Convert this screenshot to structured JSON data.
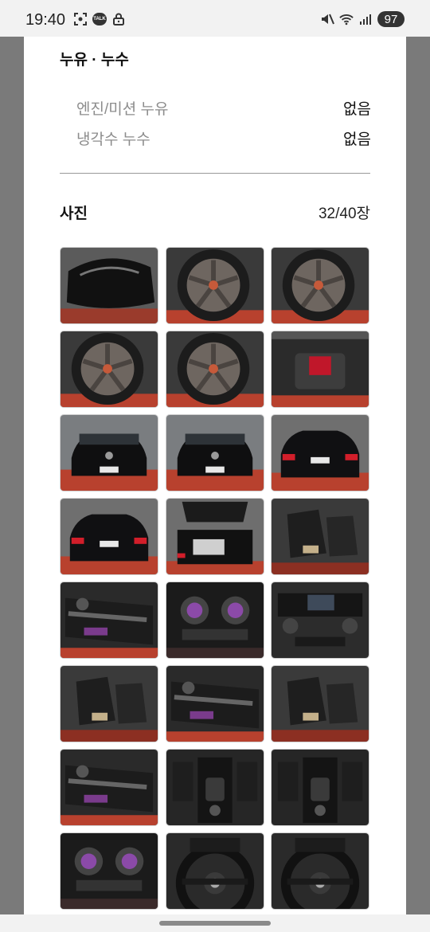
{
  "status_bar": {
    "time": "19:40",
    "talk_badge": "TALK",
    "battery": "97",
    "icons": [
      "screenshot-icon",
      "kakaotalk-icon",
      "lock-icon",
      "mute-icon",
      "wifi-icon",
      "signal-icon",
      "battery-icon"
    ]
  },
  "leak": {
    "title": "누유 · 누수",
    "rows": [
      {
        "label": "엔진/미션 누유",
        "value": "없음"
      },
      {
        "label": "냉각수 누수",
        "value": "없음"
      }
    ]
  },
  "photos": {
    "title": "사진",
    "count": "32/40장",
    "items": [
      {
        "name": "side-mirror-photo",
        "kind": "mirror"
      },
      {
        "name": "wheel-photo",
        "kind": "wheel"
      },
      {
        "name": "wheel-photo",
        "kind": "wheel"
      },
      {
        "name": "wheel-photo",
        "kind": "wheel"
      },
      {
        "name": "wheel-photo",
        "kind": "wheel"
      },
      {
        "name": "engine-bay-photo",
        "kind": "engine"
      },
      {
        "name": "car-front-photo",
        "kind": "front"
      },
      {
        "name": "car-front-angle-photo",
        "kind": "front"
      },
      {
        "name": "car-rear-photo",
        "kind": "rear"
      },
      {
        "name": "car-rear-angle-photo",
        "kind": "rear"
      },
      {
        "name": "trunk-open-photo",
        "kind": "trunk"
      },
      {
        "name": "rear-seat-photo",
        "kind": "seat"
      },
      {
        "name": "door-panel-photo",
        "kind": "door"
      },
      {
        "name": "rear-vents-photo",
        "kind": "vent"
      },
      {
        "name": "dashboard-photo",
        "kind": "dash"
      },
      {
        "name": "front-seats-photo",
        "kind": "seat"
      },
      {
        "name": "door-seat-controls-photo",
        "kind": "door"
      },
      {
        "name": "driver-seat-photo",
        "kind": "seat"
      },
      {
        "name": "door-ambient-light-photo",
        "kind": "door"
      },
      {
        "name": "center-console-photo",
        "kind": "console"
      },
      {
        "name": "gear-console-photo",
        "kind": "console"
      },
      {
        "name": "air-vents-photo",
        "kind": "vent"
      },
      {
        "name": "steering-wheel-photo",
        "kind": "steering"
      },
      {
        "name": "steering-controls-photo",
        "kind": "steering"
      }
    ]
  },
  "colors": {
    "background": "#7a7a7a",
    "sheet": "#ffffff",
    "label_gray": "#8c8c8c",
    "text": "#111111",
    "floor_red": "#b8412e"
  }
}
